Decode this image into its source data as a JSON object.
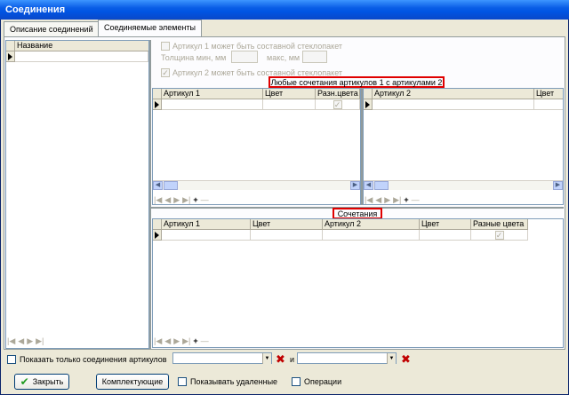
{
  "window": {
    "title": "Соединения"
  },
  "tabs": [
    {
      "label": "Описание соединений"
    },
    {
      "label": "Соединяемые элементы"
    }
  ],
  "left_grid": {
    "header": "Название"
  },
  "options": {
    "art1_composite": "Артикул 1 может быть составной стеклопакет",
    "thickness_label": "Толщина мин, мм",
    "max_label": "макс, мм",
    "art2_composite": "Артикул 2 может быть составной стеклопакет"
  },
  "combo_section": {
    "label": "Любые сочетания артикулов 1 с артикулами 2"
  },
  "grid_a1": {
    "columns": [
      "Артикул 1",
      "Цвет",
      "Разн.цвета"
    ]
  },
  "grid_a2": {
    "columns": [
      "Артикул 2",
      "Цвет"
    ]
  },
  "combos_section": {
    "label": "Сочетания"
  },
  "grid_combos": {
    "columns": [
      "Артикул 1",
      "Цвет",
      "Артикул 2",
      "Цвет",
      "Разные цвета"
    ]
  },
  "bottom": {
    "show_only_label": "Показать только соединения артикулов",
    "and_label": "и",
    "close_label": "Закрыть",
    "kits_label": "Комплектующие",
    "show_deleted_label": "Показывать удаленные",
    "operations_label": "Операции"
  }
}
